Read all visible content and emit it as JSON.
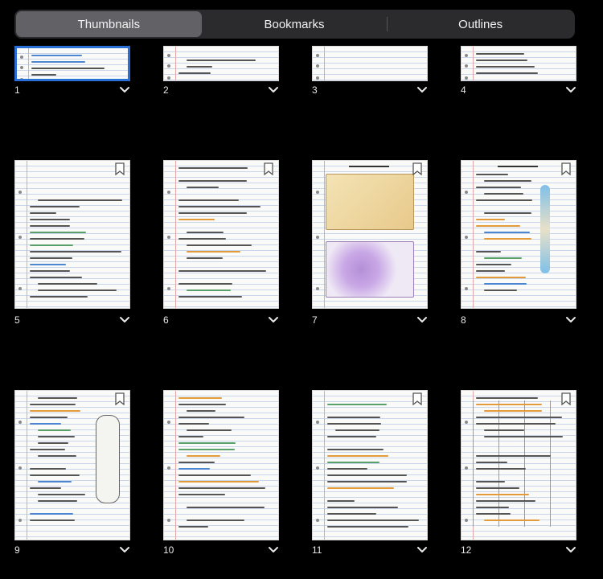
{
  "tabs": [
    {
      "label": "Thumbnails",
      "active": true
    },
    {
      "label": "Bookmarks",
      "active": false
    },
    {
      "label": "Outlines",
      "active": false
    }
  ],
  "pages": [
    {
      "number": "1",
      "selected": true,
      "bookmark": false,
      "kind": "text"
    },
    {
      "number": "2",
      "selected": false,
      "bookmark": false,
      "kind": "text"
    },
    {
      "number": "3",
      "selected": false,
      "bookmark": false,
      "kind": "blank"
    },
    {
      "number": "4",
      "selected": false,
      "bookmark": false,
      "kind": "text"
    },
    {
      "number": "5",
      "selected": false,
      "bookmark": true,
      "kind": "notes"
    },
    {
      "number": "6",
      "selected": false,
      "bookmark": true,
      "kind": "notes"
    },
    {
      "number": "7",
      "selected": false,
      "bookmark": true,
      "kind": "compact-bone"
    },
    {
      "number": "8",
      "selected": false,
      "bookmark": true,
      "kind": "long-bone"
    },
    {
      "number": "9",
      "selected": false,
      "bookmark": true,
      "kind": "classification"
    },
    {
      "number": "10",
      "selected": false,
      "bookmark": false,
      "kind": "notes"
    },
    {
      "number": "11",
      "selected": false,
      "bookmark": true,
      "kind": "notes"
    },
    {
      "number": "12",
      "selected": false,
      "bookmark": true,
      "kind": "table"
    }
  ]
}
